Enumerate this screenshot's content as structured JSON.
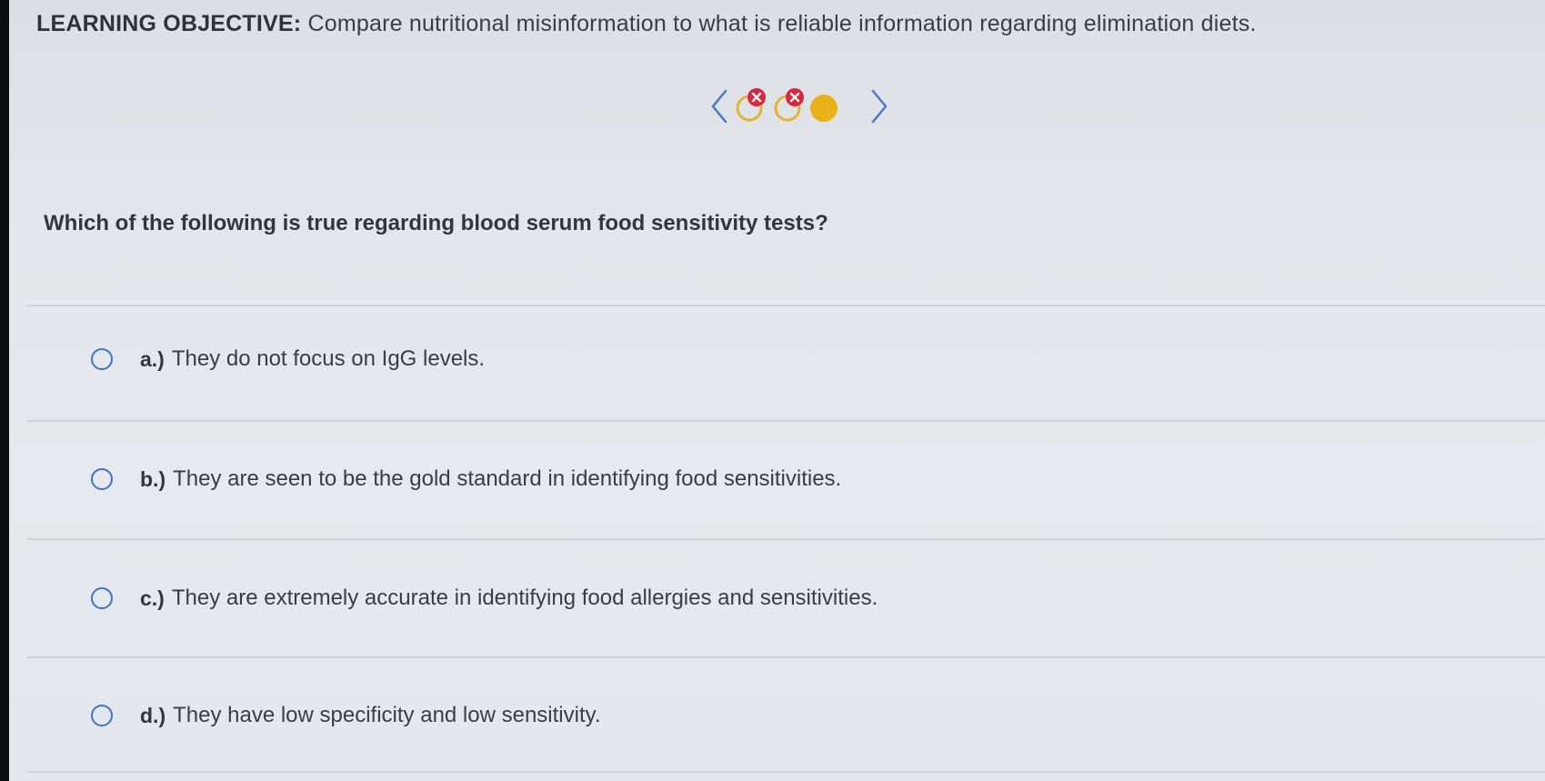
{
  "objective": {
    "lead": "LEARNING OBJECTIVE:",
    "text": "Compare nutritional misinformation to what is reliable information regarding elimination diets."
  },
  "progress": {
    "prev_label": "<",
    "next_label": ">",
    "items": [
      {
        "status": "incorrect",
        "icon": "x-icon"
      },
      {
        "status": "incorrect",
        "icon": "x-icon"
      },
      {
        "status": "current",
        "icon": "filled-dot"
      }
    ],
    "colors": {
      "ring": "#e2b43a",
      "incorrect_badge": "#d9273d",
      "current_fill": "#e9b21b",
      "arrow": "#4a79c9"
    }
  },
  "question": {
    "text": "Which of the following is true regarding blood serum food sensitivity tests?"
  },
  "options": [
    {
      "letter": "a.)",
      "text": "They do not focus on IgG levels."
    },
    {
      "letter": "b.)",
      "text": "They are seen to be the gold standard in identifying food sensitivities."
    },
    {
      "letter": "c.)",
      "text": "They are extremely accurate in identifying food allergies and sensitivities."
    },
    {
      "letter": "d.)",
      "text": "They have low specificity and low sensitivity."
    }
  ]
}
